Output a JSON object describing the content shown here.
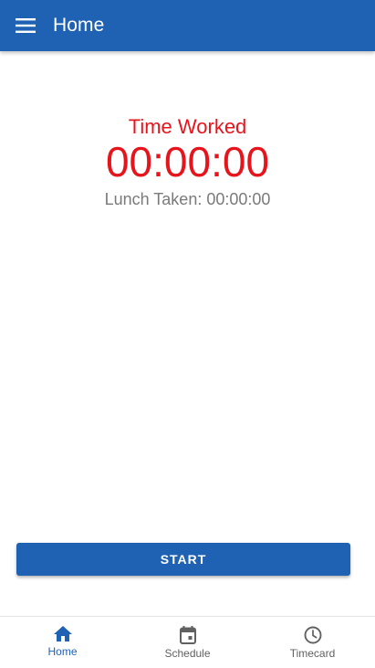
{
  "app_bar": {
    "title": "Home",
    "menu_icon": "hamburger-menu-icon"
  },
  "timer": {
    "label": "Time Worked",
    "value": "00:00:00",
    "lunch_label": "Lunch Taken: 00:00:00"
  },
  "actions": {
    "start_label": "START"
  },
  "bottom_nav": {
    "items": [
      {
        "label": "Home",
        "icon": "home-icon",
        "active": true
      },
      {
        "label": "Schedule",
        "icon": "calendar-icon",
        "active": false
      },
      {
        "label": "Timecard",
        "icon": "clock-icon",
        "active": false
      }
    ]
  },
  "colors": {
    "primary": "#1f62b3",
    "timer_red": "#e8141c",
    "muted_text": "#7a7a7a",
    "nav_inactive": "#616161"
  }
}
